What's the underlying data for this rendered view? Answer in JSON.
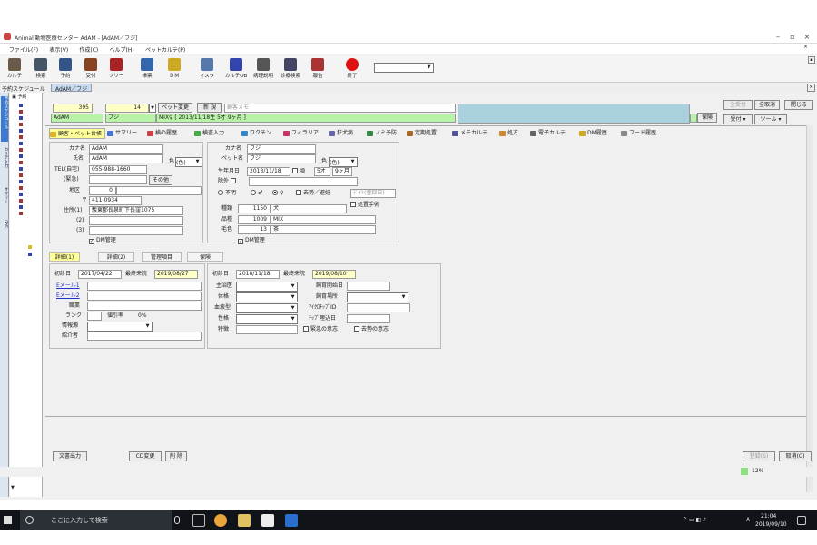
{
  "window": {
    "title": "Animal 動物医療センター AdAM - [AdAM／フジ]",
    "controls": [
      "–",
      "▫",
      "×"
    ],
    "mdi_controls": [
      "–",
      "▫",
      "×"
    ]
  },
  "menu": [
    "ファイル(F)",
    "表示(V)",
    "作成(C)",
    "ヘルプ(H)",
    "ペットカルテ(P)"
  ],
  "toolbar": {
    "buttons": [
      {
        "label": "カルテ",
        "icon": "skull-icon",
        "color": "#6b5a4a"
      },
      {
        "label": "検索",
        "icon": "binoculars-icon",
        "color": "#445566"
      },
      {
        "label": "予約",
        "icon": "calendar-icon",
        "color": "#335588"
      },
      {
        "label": "受付",
        "icon": "reception-icon",
        "color": "#884422"
      },
      {
        "label": "ツリー",
        "icon": "tree-icon",
        "color": "#aa2222"
      },
      {
        "label": "帳票",
        "icon": "print-icon",
        "color": "#3366aa"
      },
      {
        "label": "ＤＭ",
        "icon": "mail-icon",
        "color": "#ccaa22"
      },
      {
        "label": "マスタ",
        "icon": "master-icon",
        "color": "#5577aa"
      },
      {
        "label": "カルテOB",
        "icon": "pen-icon",
        "color": "#3344aa"
      },
      {
        "label": "病理説明",
        "icon": "document-icon",
        "color": "#555555"
      },
      {
        "label": "診療検索",
        "icon": "magnifier-icon",
        "color": "#444466"
      },
      {
        "label": "報告",
        "icon": "report-icon",
        "color": "#aa3333"
      },
      {
        "label": "終了",
        "icon": "stop-icon",
        "color": "#dd1111"
      }
    ],
    "combo_value": ""
  },
  "breadcrumb": {
    "label": "予約スケジュール",
    "current": "AdAM／フジ"
  },
  "left_nav": [
    "予約スケジュール",
    "カルテ入力",
    "サマリー",
    "分析"
  ],
  "header": {
    "id": "395",
    "pet_no": "14",
    "pet_change_button": "ペット変更",
    "new_button": "新 規",
    "memo_placeholder": "顧客メモ",
    "client_name": "AdAM",
    "pet_name": "フジ",
    "pet_info": "MIX♀ [ 2013/11/18生 5才 9ヶ月 ]",
    "insurance_button": "保険",
    "right_buttons": {
      "accept_all": "全受付",
      "cancel_all": "全取消",
      "close": "閉じる",
      "reception": "受付",
      "tool": "ツール"
    }
  },
  "tabs": [
    {
      "label": "顧客・ペット台帳",
      "color": "#e0b020",
      "selected": true
    },
    {
      "label": "サマリー",
      "color": "#4477cc"
    },
    {
      "label": "検の履歴",
      "color": "#cc4444"
    },
    {
      "label": "検査入力",
      "color": "#44aa44"
    },
    {
      "label": "ワクチン",
      "color": "#3388cc"
    },
    {
      "label": "フィラリア",
      "color": "#cc3366"
    },
    {
      "label": "狂犬病",
      "color": "#6666aa"
    },
    {
      "label": "ノミ予防",
      "color": "#338844"
    },
    {
      "label": "定期処置",
      "color": "#aa6622"
    },
    {
      "label": "メモカルテ",
      "color": "#555599"
    },
    {
      "label": "処方",
      "color": "#cc8833"
    },
    {
      "label": "電子カルテ",
      "color": "#666666"
    },
    {
      "label": "DM履歴",
      "color": "#ccaa22"
    },
    {
      "label": "フード履歴",
      "color": "#888888"
    }
  ],
  "client": {
    "kana_label": "カナ名",
    "kana": "AdAM",
    "name_label": "氏名",
    "name": "AdAM",
    "color_label": "色",
    "color_value": "(色)",
    "tel_label": "TEL(自宅)",
    "tel": "055-988-1660",
    "mobile_label": "(緊急)",
    "other_button": "その他",
    "area_label": "地区",
    "area": "0",
    "zip_label": "〒",
    "zip": "411-0934",
    "addr1_label": "住所(1)",
    "addr1": "駿東郡長泉町下長窪1075",
    "addr2_label": "(2)",
    "addr2": "",
    "addr3_label": "(3)",
    "addr3": "",
    "dm_label": "DM管理",
    "dm_checked": true
  },
  "pet": {
    "kana_label": "カナ名",
    "kana": "フジ",
    "name_label": "ペット名",
    "name": "フジ",
    "color_label": "色",
    "color_value": "(色)",
    "birth_label": "生年月日",
    "birth": "2013/11/18",
    "birth_estimate": "頃",
    "age_years": "5才",
    "age_months": "9ヶ月",
    "death_label": "除外",
    "sex_options": [
      "不明",
      "♂",
      "♀"
    ],
    "sex_selected": "♀",
    "neutered_label": "去勢／避妊",
    "neuter_date_placeholder": "ﾃﾞｲﾄ(登録日)",
    "no_surgery_label": "処置手術",
    "species_label": "種類",
    "species_code": "1150",
    "species": "犬",
    "breed_label": "品種",
    "breed_code": "1009",
    "breed": "MIX",
    "coat_label": "毛色",
    "coat_code": "13",
    "coat": "茶",
    "dm_label": "DM管理",
    "dm_checked": true
  },
  "subtabs": [
    {
      "label": "詳細(1)",
      "selected": true
    },
    {
      "label": "詳細(2)"
    },
    {
      "label": "管理項目"
    },
    {
      "label": "保険"
    }
  ],
  "detail_client": {
    "first_visit_label": "初診日",
    "first_visit": "2017/04/22",
    "last_visit_label": "最終来院",
    "last_visit": "2019/08/27",
    "email1_label": "Eメール1",
    "email2_label": "Eメール2",
    "job_label": "職業",
    "rank_label": "ランク",
    "discount_label": "値引率",
    "discount": "0%",
    "info_label": "情報源",
    "referrer_label": "紹介者"
  },
  "detail_pet": {
    "first_visit_label": "初診日",
    "first_visit": "2018/11/18",
    "last_visit_label": "最終来院",
    "last_visit": "2019/08/10",
    "doctor_label": "主治医",
    "feed_start_label": "飼育開始日",
    "body_label": "体格",
    "feed_place_label": "飼育場所",
    "blood_label": "血液型",
    "microchip_label": "ﾏｲｸﾛﾁｯﾌﾟID",
    "temper_label": "性格",
    "chip_date_label": "ﾁｯﾌﾟ埋込日",
    "note_label": "特徴",
    "deceased_label": "緊急の意志",
    "cremation_label": "去勢の意志"
  },
  "bottom": {
    "doc_button": "文書出力",
    "cd_button": "CD変更",
    "delete_button": "削 除",
    "register_button": "登録(S)",
    "cancel_button": "取消(C)",
    "zoom": "12%"
  },
  "taskbar": {
    "search_placeholder": "ここに入力して検索",
    "time": "21:04",
    "date": "2019/09/10",
    "ime": "A"
  }
}
